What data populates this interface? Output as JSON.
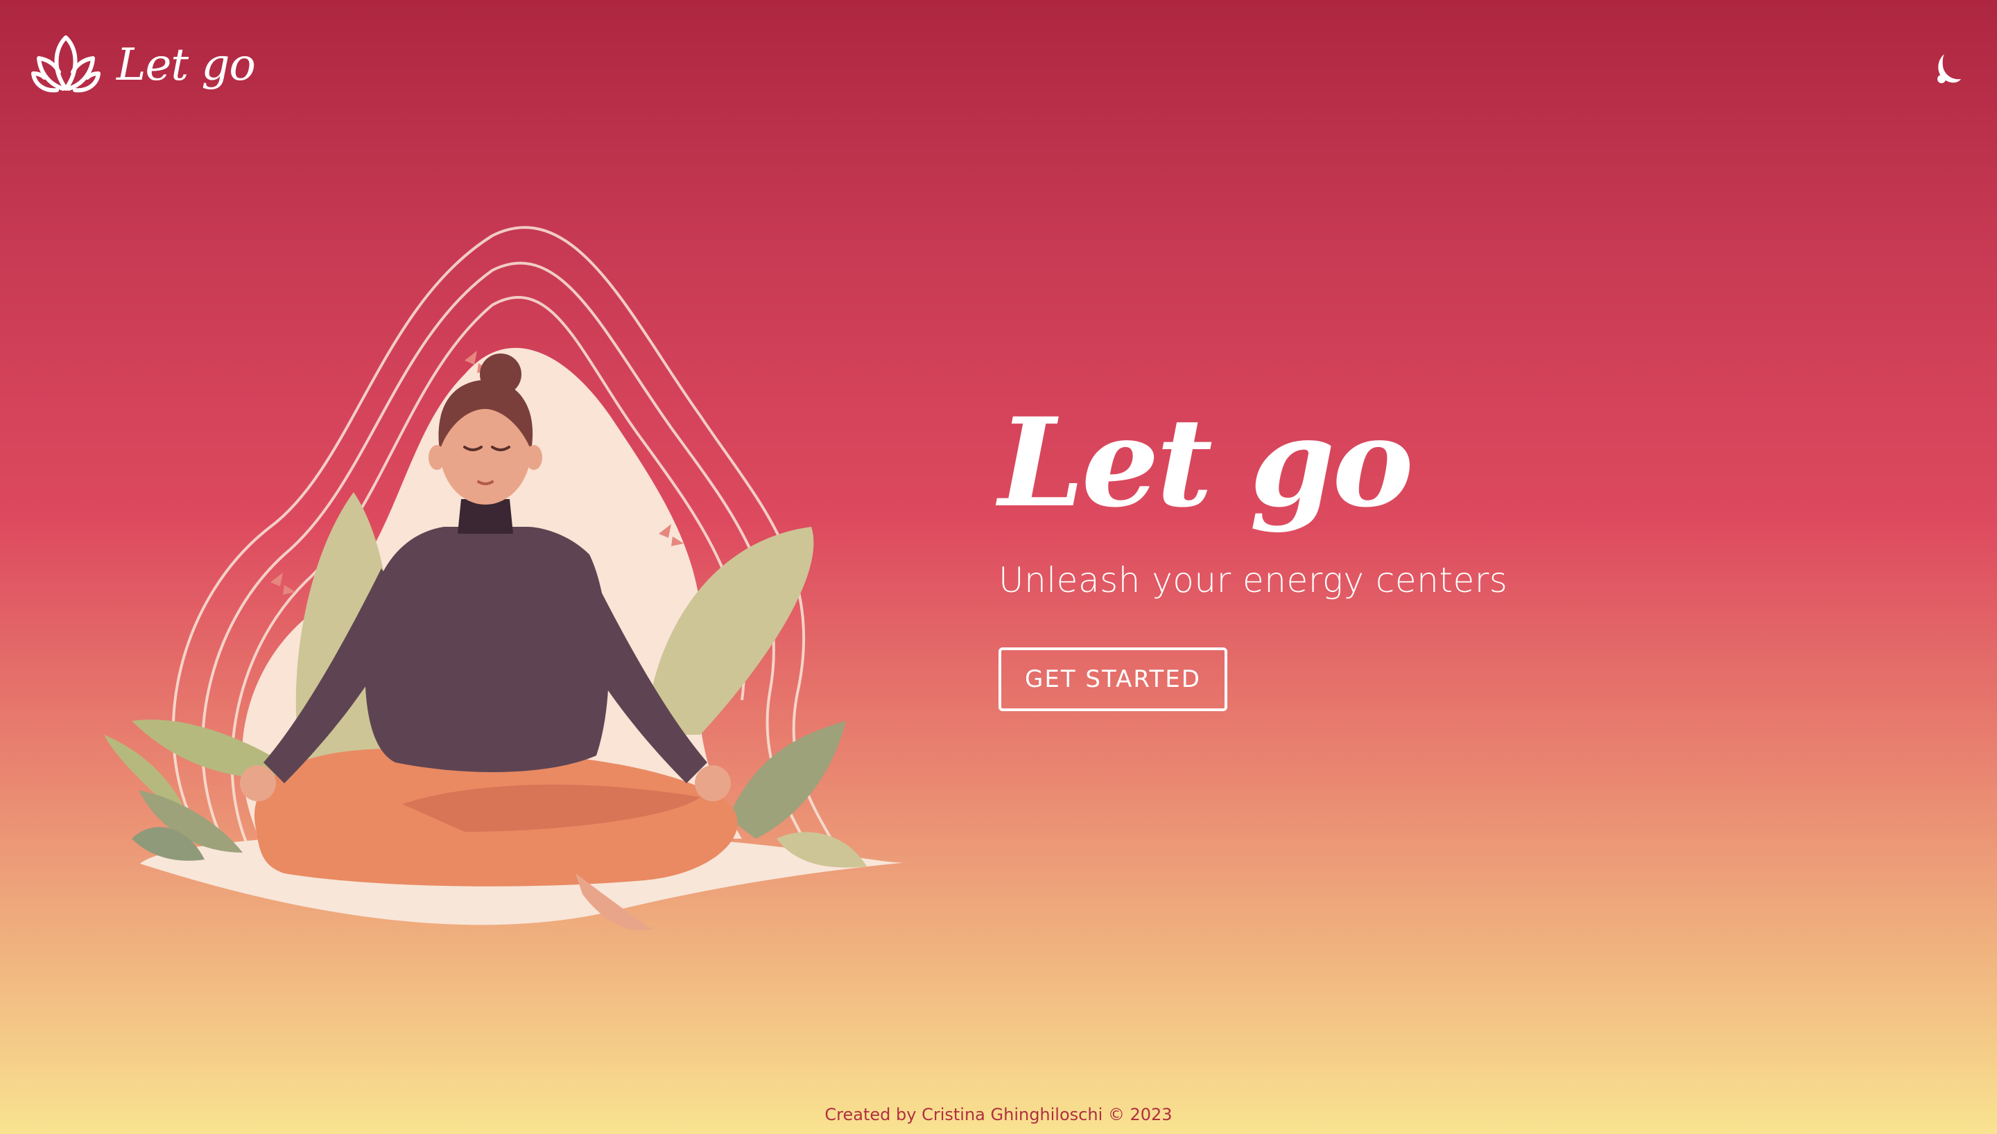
{
  "header": {
    "brand_name": "Let go",
    "logo_icon": "lotus-icon",
    "theme_toggle_icon": "moon-icon"
  },
  "hero": {
    "title": "Let go",
    "subtitle": "Unleash your energy centers",
    "cta_label": "GET STARTED"
  },
  "footer": {
    "credit": "Created by Cristina Ghinghiloschi © 2023"
  },
  "colors": {
    "gradient_top": "#ad2640",
    "gradient_mid": "#dd4a5f",
    "gradient_bottom": "#f9e391",
    "footer_text": "#b03040",
    "white": "#ffffff"
  }
}
